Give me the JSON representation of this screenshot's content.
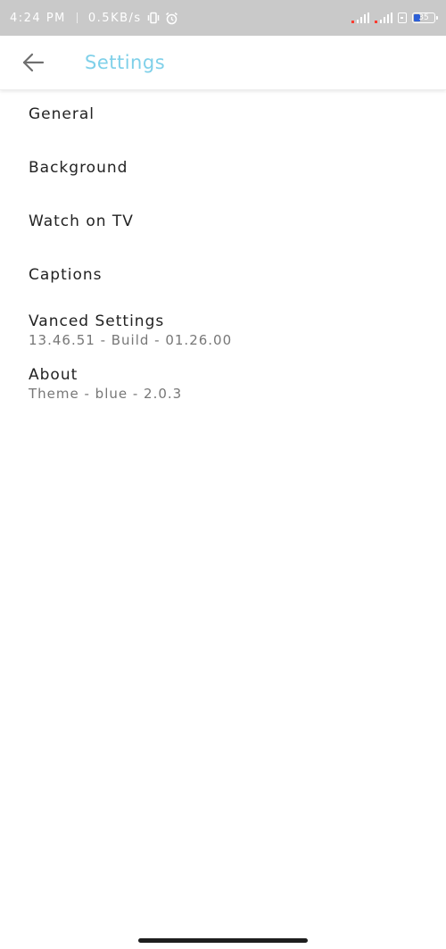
{
  "status_bar": {
    "time": "4:24 PM",
    "net_speed": "0.5KB/s",
    "battery_level": "35",
    "battery_fraction": 0.35,
    "icons": [
      "vibrate-icon",
      "alarm-icon",
      "signal-icon",
      "signal-icon",
      "sim-icon",
      "battery-icon"
    ]
  },
  "app_bar": {
    "title": "Settings",
    "back_icon": "arrow-back-icon",
    "title_color": "#7fd0e9"
  },
  "settings": {
    "items": [
      {
        "title": "General"
      },
      {
        "title": "Background"
      },
      {
        "title": "Watch on TV"
      },
      {
        "title": "Captions"
      },
      {
        "title": "Vanced Settings",
        "summary": "13.46.51 - Build - 01.26.00"
      },
      {
        "title": "About",
        "summary": "Theme - blue - 2.0.3"
      }
    ]
  }
}
